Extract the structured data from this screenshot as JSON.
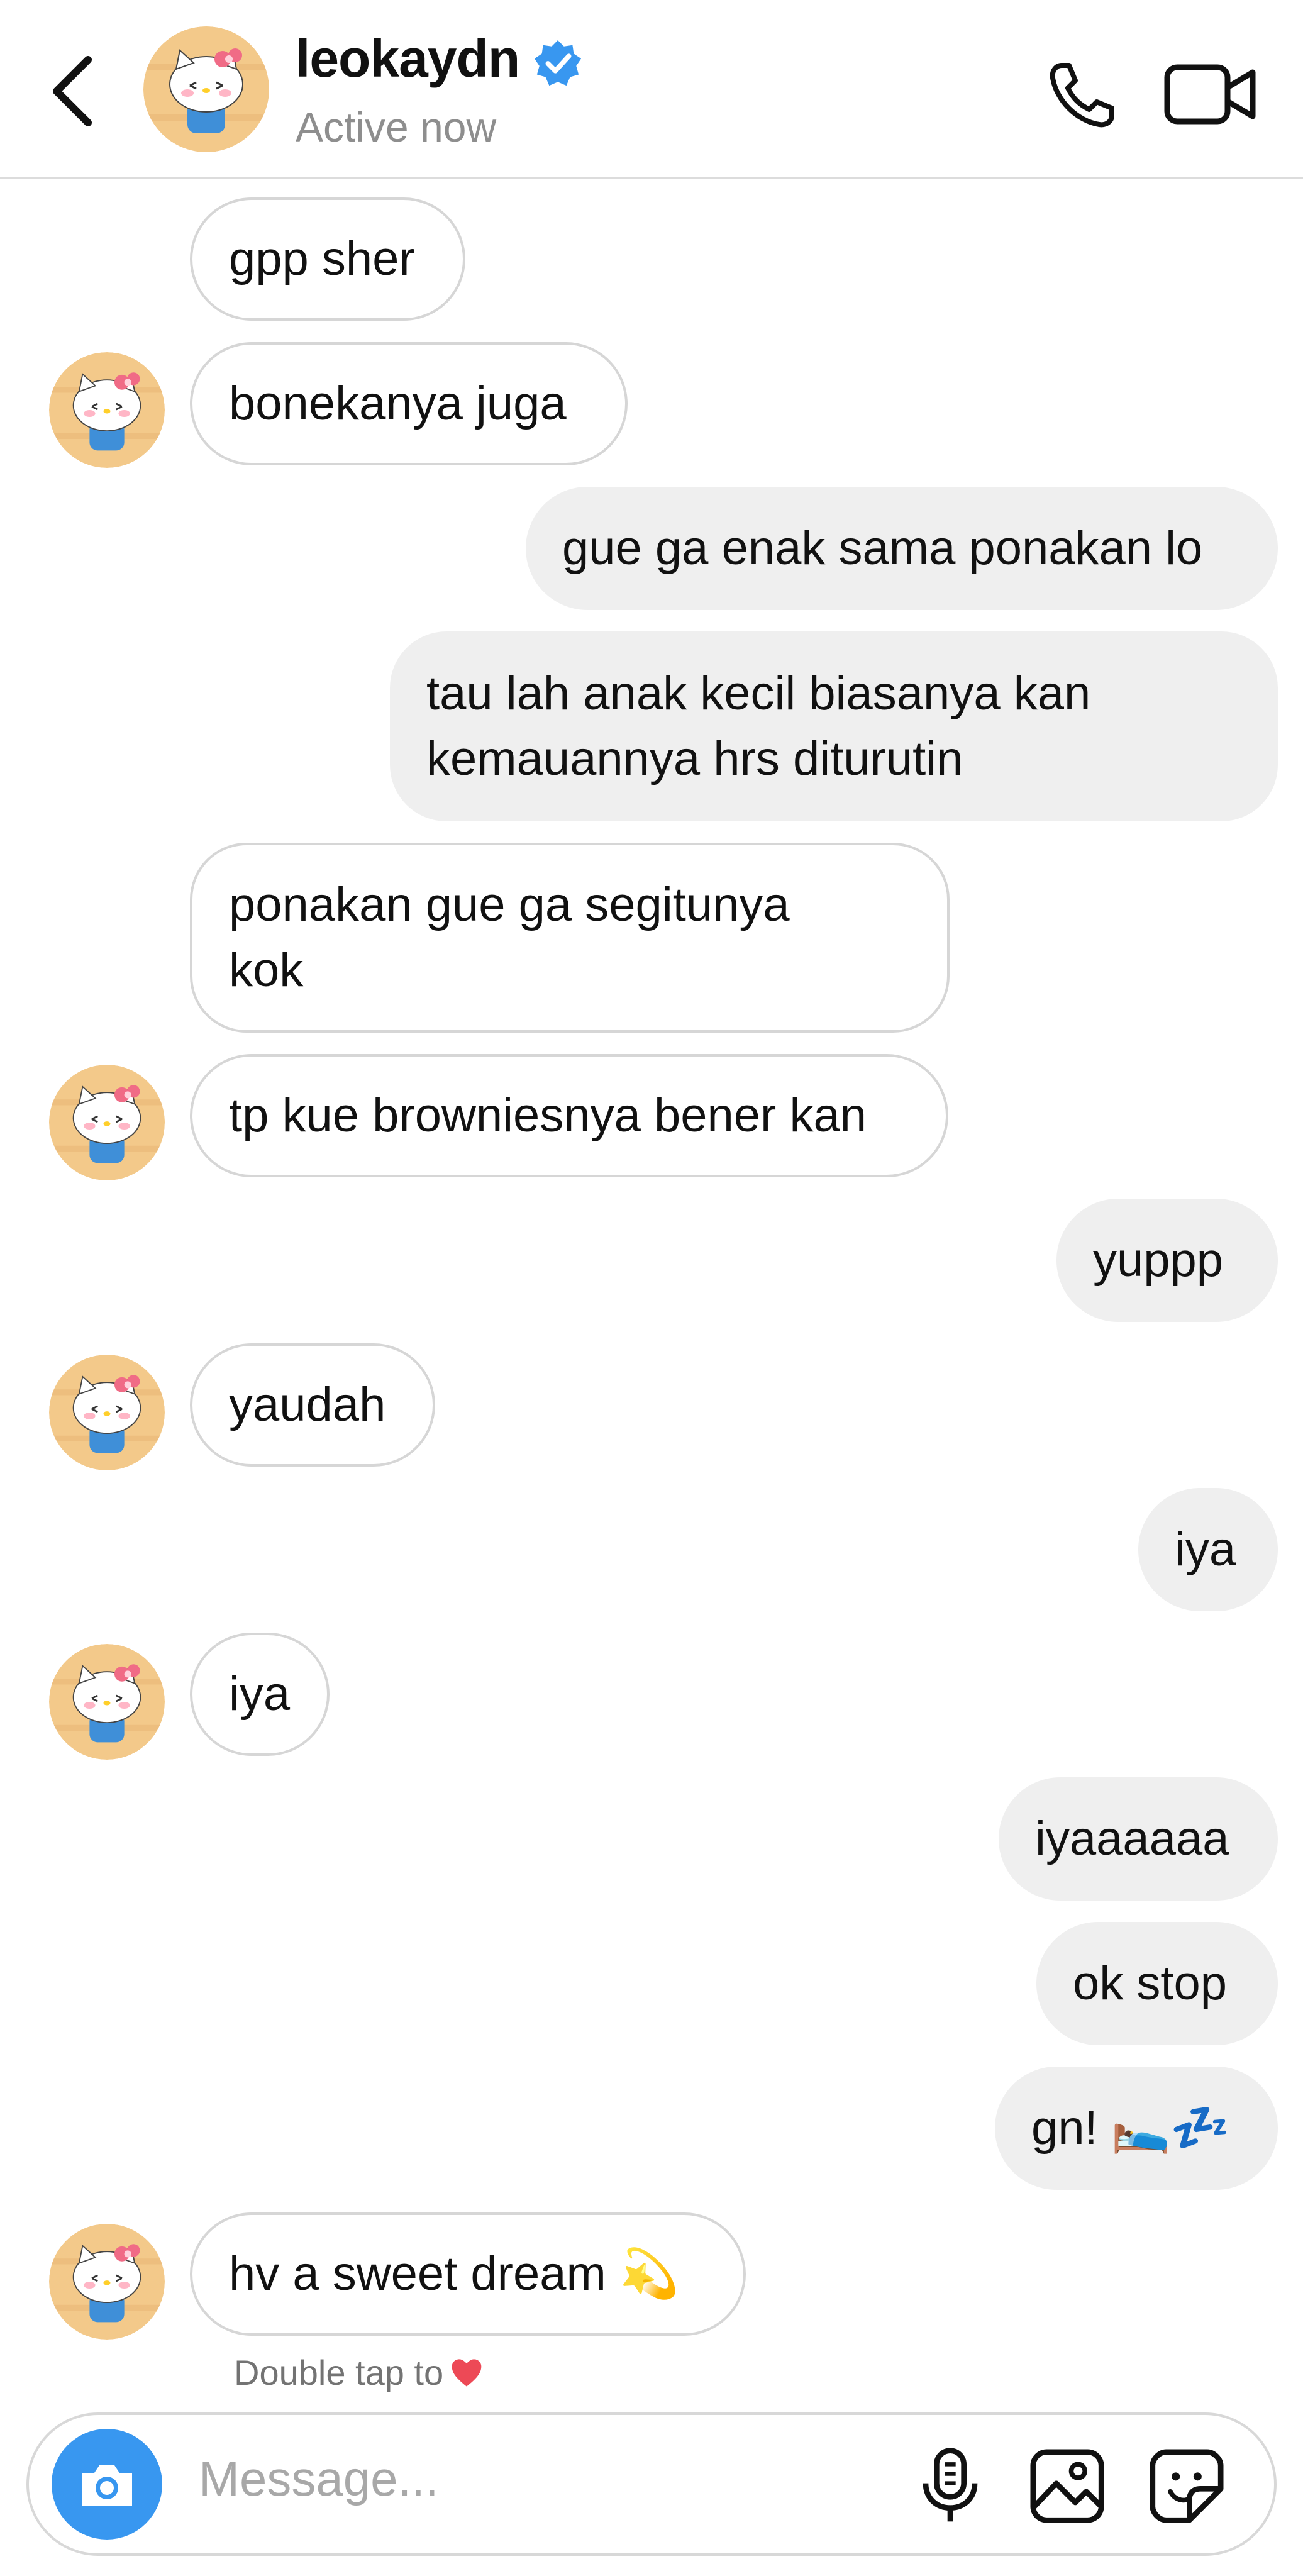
{
  "header": {
    "username": "leokaydn",
    "status": "Active now",
    "icons": [
      "back-icon",
      "verified-badge-icon",
      "phone-icon",
      "video-camera-icon"
    ]
  },
  "messages": [
    {
      "side": "in",
      "text": "gpp sher"
    },
    {
      "side": "in",
      "text": "bonekanya juga"
    },
    {
      "side": "out",
      "text": "gue ga enak sama ponakan lo"
    },
    {
      "side": "out",
      "text": "tau lah anak kecil biasanya kan\nkemauannya hrs diturutin"
    },
    {
      "side": "in",
      "text": "ponakan gue ga segitunya\nkok"
    },
    {
      "side": "in",
      "text": "tp kue browniesnya bener kan"
    },
    {
      "side": "out",
      "text": "yuppp"
    },
    {
      "side": "in",
      "text": "yaudah"
    },
    {
      "side": "out",
      "text": "iya"
    },
    {
      "side": "in",
      "text": "iya"
    },
    {
      "side": "out",
      "text": "iyaaaaaa"
    },
    {
      "side": "out",
      "text": "ok stop"
    },
    {
      "side": "out",
      "text": "gn! 🛌💤"
    },
    {
      "side": "in",
      "text": "hv a sweet dream 💫"
    }
  ],
  "hint": {
    "text": "Double tap to",
    "icon": "heart-icon"
  },
  "composer": {
    "placeholder": "Message...",
    "icons": [
      "camera-icon",
      "microphone-icon",
      "gallery-icon",
      "sticker-icon"
    ]
  },
  "colors": {
    "accent": "#3897f0",
    "verified": "#3897f0",
    "heart": "#ed4956",
    "outgoing_bubble": "#efefef"
  }
}
